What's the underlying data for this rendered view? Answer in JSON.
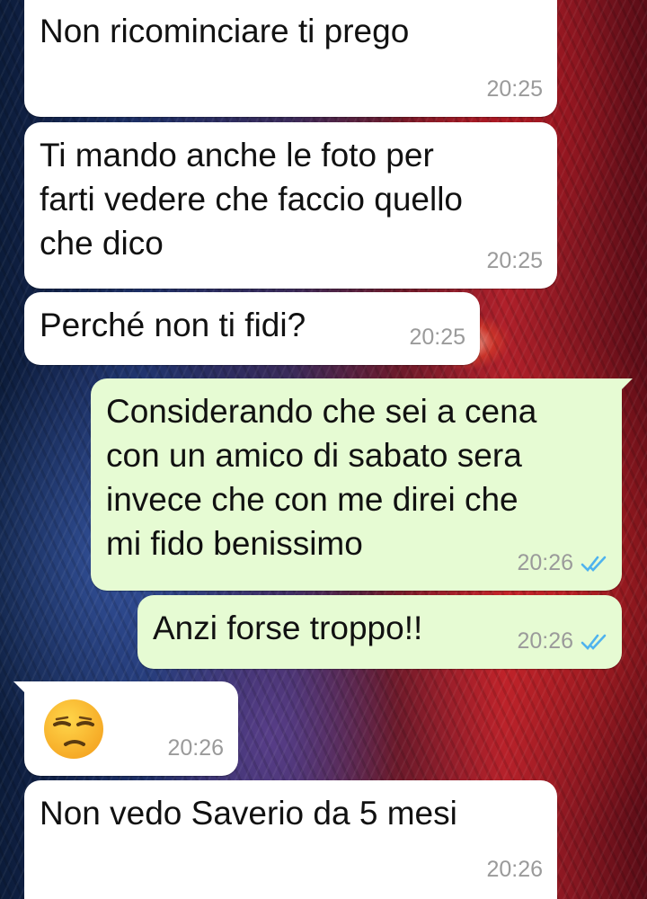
{
  "messages": [
    {
      "direction": "in",
      "text": "Non ricominciare ti prego",
      "time": "20:25"
    },
    {
      "direction": "in",
      "text": "Ti mando anche le foto per\nfarti vedere che faccio quello\nche dico",
      "time": "20:25"
    },
    {
      "direction": "in",
      "text": "Perché non ti fidi?",
      "time": "20:25"
    },
    {
      "direction": "out",
      "text": "Considerando che sei a cena\ncon un amico di sabato sera\ninvece che con me direi che\nmi fido benissimo",
      "time": "20:26",
      "status": "read"
    },
    {
      "direction": "out",
      "text": "Anzi forse troppo!!",
      "time": "20:26",
      "status": "read"
    },
    {
      "direction": "in",
      "emoji": "unamused-face",
      "time": "20:26"
    },
    {
      "direction": "in",
      "text": "Non vedo Saverio da 5 mesi",
      "time": "20:26"
    }
  ],
  "colors": {
    "incoming_bubble": "#ffffff",
    "outgoing_bubble": "#e6fbd3",
    "read_check": "#4fb3ee",
    "timestamp": "#9a9a9a"
  }
}
